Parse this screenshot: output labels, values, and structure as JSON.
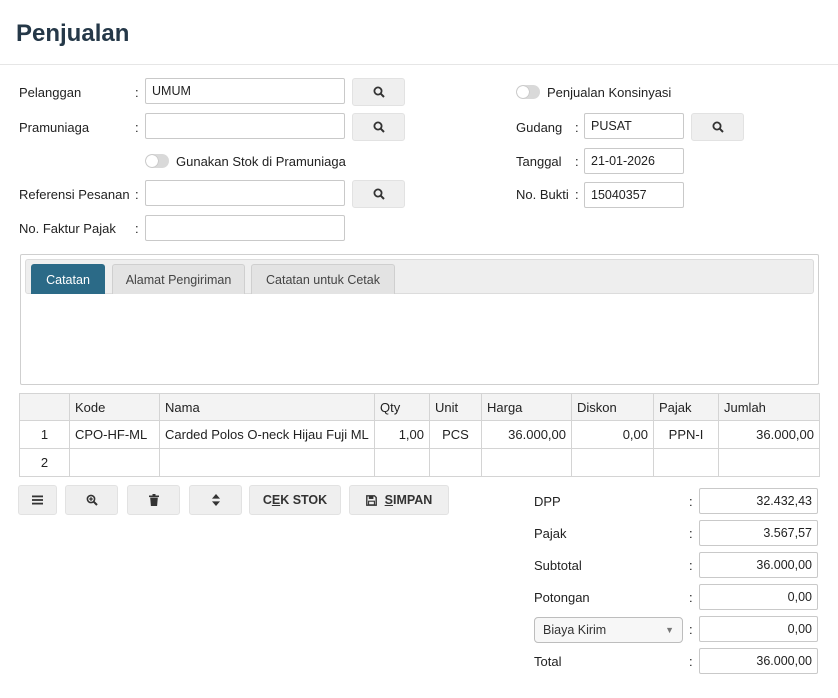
{
  "page": {
    "title": "Penjualan"
  },
  "form": {
    "pelanggan": {
      "label": "Pelanggan",
      "value": "UMUM"
    },
    "pramuniaga": {
      "label": "Pramuniaga",
      "value": ""
    },
    "stok_toggle_label": "Gunakan Stok di Pramuniaga",
    "referensi": {
      "label": "Referensi Pesanan",
      "value": ""
    },
    "faktur": {
      "label": "No. Faktur Pajak",
      "value": ""
    },
    "konsinyasi_label": "Penjualan Konsinyasi",
    "gudang": {
      "label": "Gudang",
      "value": "PUSAT"
    },
    "tanggal": {
      "label": "Tanggal",
      "value": "21-01-2026"
    },
    "bukti": {
      "label": "No. Bukti",
      "value": "15040357"
    },
    "colon": ":"
  },
  "tabs": [
    {
      "label": "Catatan"
    },
    {
      "label": "Alamat Pengiriman"
    },
    {
      "label": "Catatan untuk Cetak"
    }
  ],
  "table": {
    "headers": [
      "",
      "Kode",
      "Nama",
      "Qty",
      "Unit",
      "Harga",
      "Diskon",
      "Pajak",
      "Jumlah"
    ],
    "rows": [
      {
        "no": "1",
        "kode": "CPO-HF-ML",
        "nama": "Carded Polos O-neck Hijau Fuji ML",
        "qty": "1,00",
        "unit": "PCS",
        "harga": "36.000,00",
        "diskon": "0,00",
        "pajak": "PPN-I",
        "jumlah": "36.000,00"
      },
      {
        "no": "2",
        "kode": "",
        "nama": "",
        "qty": "",
        "unit": "",
        "harga": "",
        "diskon": "",
        "pajak": "",
        "jumlah": ""
      }
    ]
  },
  "toolbar": {
    "cek_stok": {
      "prefix": "C",
      "underline": "E",
      "rest": "K STOK"
    },
    "simpan": {
      "underline": "S",
      "rest": "IMPAN"
    }
  },
  "totals": {
    "dpp": {
      "label": "DPP",
      "value": "32.432,43"
    },
    "pajak": {
      "label": "Pajak",
      "value": "3.567,57"
    },
    "subtotal": {
      "label": "Subtotal",
      "value": "36.000,00"
    },
    "potongan": {
      "label": "Potongan",
      "value": "0,00"
    },
    "biaya": {
      "label": "Biaya Kirim",
      "value": "0,00"
    },
    "total": {
      "label": "Total",
      "value": "36.000,00"
    }
  },
  "icons": {
    "search": "search-icon",
    "menu": "menu-icon",
    "zoom": "zoom-icon",
    "trash": "trash-icon",
    "sort": "sort-icon",
    "save": "save-icon"
  },
  "colors": {
    "active_tab": "#2b6a87",
    "title": "#253848"
  }
}
